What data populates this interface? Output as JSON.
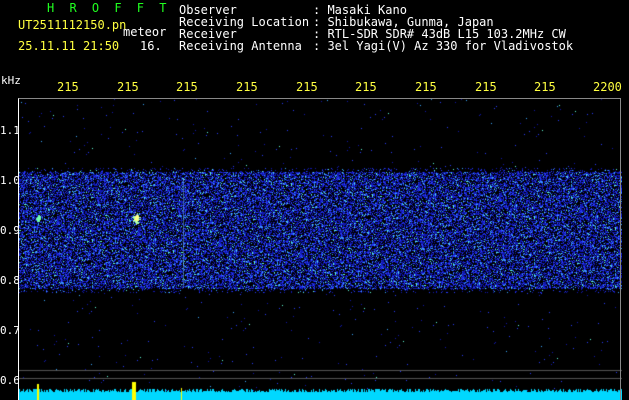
{
  "header": {
    "brand": "H R O F F T",
    "file_name": "UT2511112150.pn",
    "file_suffix": "meteor",
    "timestamp": "25.11.11 21:50",
    "count": "16."
  },
  "info": [
    {
      "label": "Observer",
      "value": ": Masaki Kano"
    },
    {
      "label": "Receiving Location",
      "value": ": Shibukawa, Gunma, Japan"
    },
    {
      "label": "Receiver",
      "value": ": RTL-SDR SDR# 43dB L15 103.2MHz CW"
    },
    {
      "label": "Receiving Antenna",
      "value": ": 3el Yagi(V) Az 330 for Vladivostok"
    }
  ],
  "axis": {
    "y_unit": "kHz",
    "x_ticks": [
      "215",
      "215",
      "215",
      "215",
      "215",
      "215",
      "215",
      "215",
      "215",
      "2200"
    ],
    "y_ticks": [
      "1.1",
      "1.0",
      "0.9",
      "0.8",
      "0.7",
      "0.6"
    ]
  },
  "colors": {
    "background": "#000000",
    "header_green": "#20ff20",
    "header_yellow": "#ffff40",
    "noise_blue": "#1e2bff",
    "noise_cyan": "#40e0ff",
    "power_cyan": "#00e0ff",
    "meteor_yellow": "#ffff00"
  }
}
